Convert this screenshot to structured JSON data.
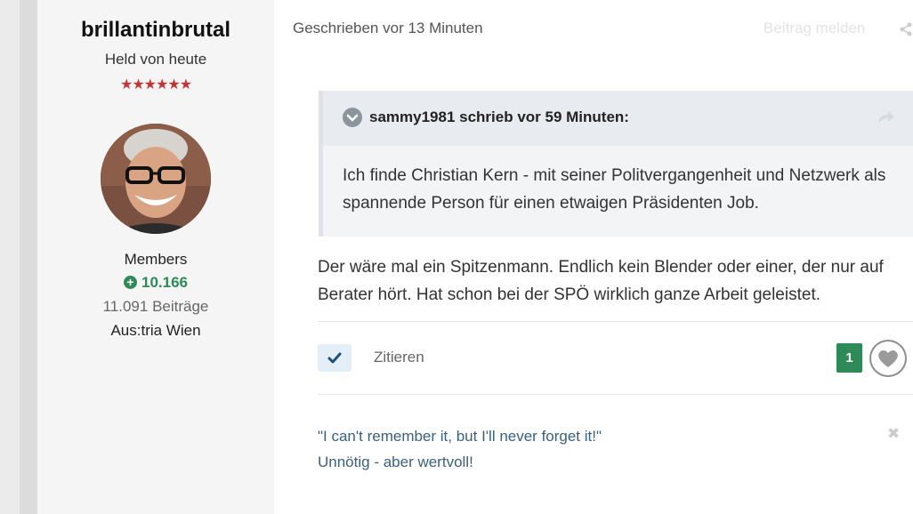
{
  "author": {
    "name": "brillantinbrutal",
    "title": "Held von heute",
    "stars": "★★★★★★",
    "group": "Members",
    "reputation": "10.166",
    "post_count": "11.091 Beiträge",
    "location": "Aus:tria Wien"
  },
  "post": {
    "meta": "Geschrieben vor 13 Minuten",
    "report_label": "Beitrag melden",
    "body": "Der wäre mal ein Spitzenmann. Endlich kein Blender oder einer, der nur auf Berater hört. Hat schon bei der SPÖ wirklich ganze Arbeit geleistet.",
    "quote": {
      "header": "sammy1981 schrieb vor 59 Minuten:",
      "text": "Ich finde Christian Kern - mit seiner Politvergangenheit und Netzwerk als spannende Person für einen etwaigen Präsidenten Job."
    },
    "actions": {
      "quote_label": "Zitieren",
      "like_count": "1"
    },
    "signature": {
      "line1": "\"I can't remember it, but I'll never forget it!\"",
      "line2": "Unnötig - aber wertvoll!"
    }
  },
  "colors": {
    "reputation_green": "#2e8b57",
    "star_red": "#c53535",
    "signature_blue": "#3a5f80"
  },
  "icons": [
    "plus-circle-icon",
    "chevron-down-icon",
    "share-icon",
    "check-icon",
    "heart-icon",
    "close-icon"
  ]
}
